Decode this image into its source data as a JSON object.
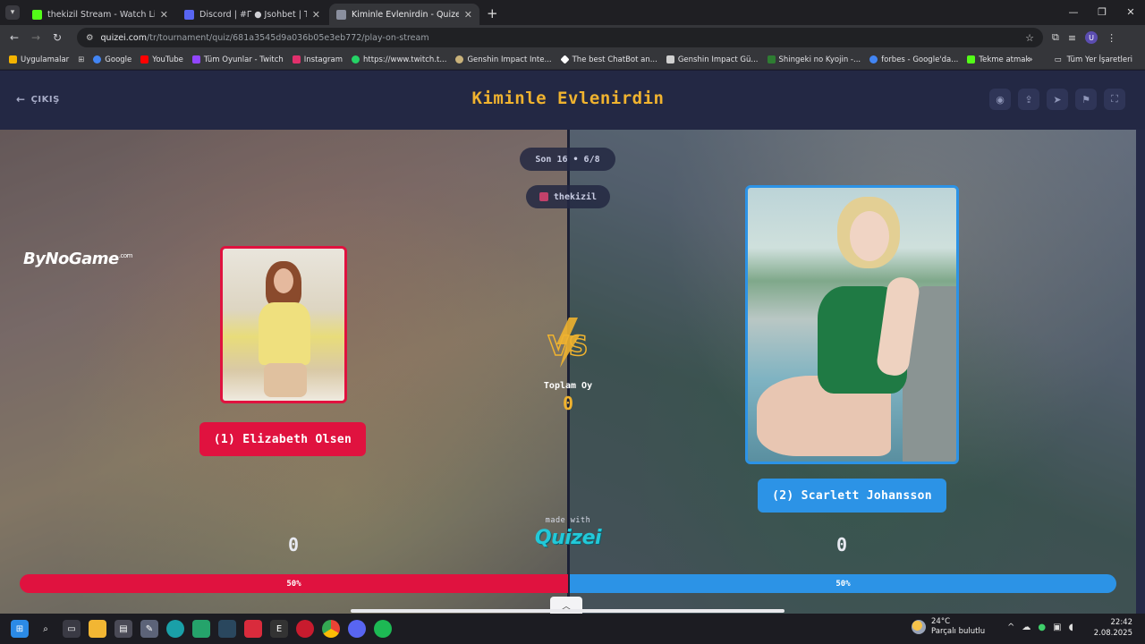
{
  "browser": {
    "tabs": [
      {
        "title": "thekizil Stream - Watch Live on",
        "color": "#53fc18",
        "active": false
      },
      {
        "title": "Discord | #Γ ● Jsohbet | Th",
        "color": "#5865f2",
        "active": false
      },
      {
        "title": "Kiminle Evlenirdin - Quizei",
        "color": "#8a8f9e",
        "active": true
      }
    ],
    "url_host": "quizei.com",
    "url_path": "/tr/tournament/quiz/681a3545d9a036b05e3eb772/play-on-stream",
    "avatar_letter": "U",
    "bookmarks": [
      {
        "label": "Uygulamalar",
        "color": "#f4b400"
      },
      {
        "label": "Google",
        "color": "#4285f4"
      },
      {
        "label": "YouTube",
        "color": "#ff0000"
      },
      {
        "label": "Tüm Oyunlar - Twitch",
        "color": "#9146ff"
      },
      {
        "label": "Instagram",
        "color": "#e1306c"
      },
      {
        "label": "https://www.twitch.t...",
        "color": "#25d366"
      },
      {
        "label": "Genshin Impact Inte...",
        "color": "#c9b27a"
      },
      {
        "label": "The best ChatBot an...",
        "color": "#ffffff"
      },
      {
        "label": "Genshin Impact Gü...",
        "color": "#d0d0d0"
      },
      {
        "label": "Shingeki no Kyojin -...",
        "color": "#2e7d32"
      },
      {
        "label": "forbes - Google'da...",
        "color": "#4285f4"
      },
      {
        "label": "Tekme atmak",
        "color": "#53fc18"
      }
    ],
    "bookmarks_other": "Tüm Yer İşaretleri"
  },
  "quiz": {
    "exit_label": "ÇIKIŞ",
    "title": "Kiminle Evlenirdin",
    "round": "Son 16 • 6/8",
    "streamer": "thekizil",
    "watermark": "ByNoGame",
    "watermark_suffix": ".com",
    "vs_label": "VS",
    "total_votes_label": "Toplam Oy",
    "total_votes": "0",
    "made_with": "made with",
    "brand": "Quizei",
    "left": {
      "name": "(1) Elizabeth Olsen",
      "score": "0",
      "percent": 50,
      "percent_label": "50%",
      "color": "#e0123f"
    },
    "right": {
      "name": "(2) Scarlett Johansson",
      "score": "0",
      "percent": 50,
      "percent_label": "50%",
      "color": "#2c93e6"
    }
  },
  "taskbar": {
    "temperature": "24°C",
    "weather": "Parçalı bulutlu",
    "time": "22:42",
    "date": "2.08.2025"
  }
}
